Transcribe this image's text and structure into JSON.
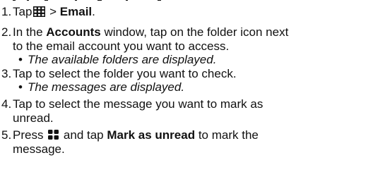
{
  "steps": [
    {
      "number": "1.",
      "lines": [
        {
          "pre": "Tap",
          "icon": "apps-grid-icon",
          "mid": " > ",
          "bold": "Email",
          "post": "."
        }
      ]
    },
    {
      "number": "2.",
      "line1_pre": "In the ",
      "line1_bold": "Accounts",
      "line1_post": " window, tap on the folder icon next",
      "line2": "to the email account you want to access.",
      "sub": "The available folders are displayed."
    },
    {
      "number": "3.",
      "line1": "Tap to select the folder you want to check.",
      "sub": "The messages are displayed."
    },
    {
      "number": "4.",
      "line1": "Tap to select the message you want to mark as",
      "line2": "unread."
    },
    {
      "number": "5.",
      "line1_pre": "Press ",
      "icon": "menu-key-icon",
      "line1_mid": " and tap ",
      "line1_bold": "Mark as unread",
      "line1_post": " to mark the",
      "line2": "message."
    }
  ],
  "bullet": "•"
}
